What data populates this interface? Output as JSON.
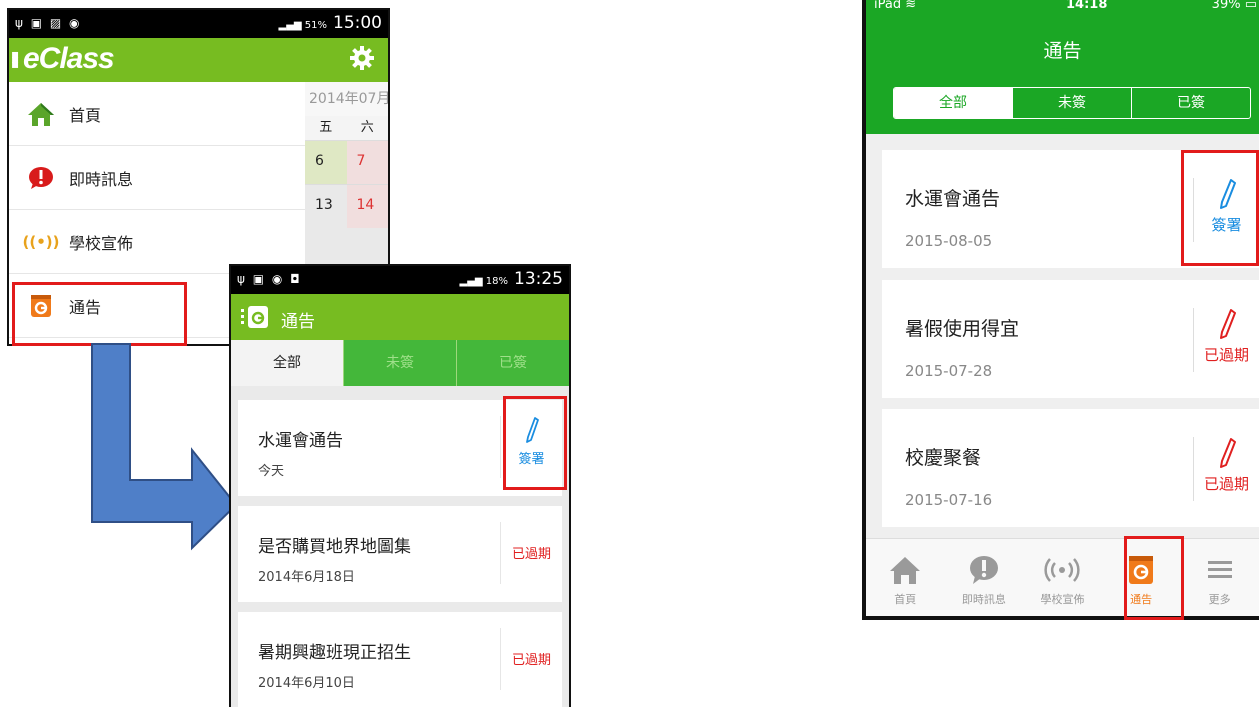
{
  "android_drawer": {
    "status": {
      "icons_left": "ψ 51",
      "battery": "51%",
      "time": "15:00"
    },
    "app_logo": "eClass",
    "calendar": {
      "month": "2014年07月",
      "weekdays": [
        "五",
        "六"
      ],
      "rows": [
        [
          "6",
          "7"
        ],
        [
          "13",
          "14"
        ]
      ]
    },
    "menu": [
      {
        "label": "首頁",
        "icon": "home-icon"
      },
      {
        "label": "即時訊息",
        "icon": "chat-alert-icon"
      },
      {
        "label": "學校宣佈",
        "icon": "broadcast-icon"
      },
      {
        "label": "通告",
        "icon": "notice-icon"
      }
    ]
  },
  "android_notices": {
    "status": {
      "battery": "18%",
      "time": "13:25"
    },
    "title": "通告",
    "tabs": [
      "全部",
      "未簽",
      "已簽"
    ],
    "notices": [
      {
        "title": "水運會通告",
        "date": "今天",
        "action": "簽署"
      },
      {
        "title": "是否購買地界地圖集",
        "date": "2014年6月18日",
        "action": "已過期"
      },
      {
        "title": "暑期興趣班現正招生",
        "date": "2014年6月10日",
        "action": "已過期"
      }
    ]
  },
  "ipad": {
    "status": {
      "carrier": "iPad",
      "time": "14:18",
      "battery": "39%"
    },
    "title": "通告",
    "tabs": [
      "全部",
      "未簽",
      "已簽"
    ],
    "notices": [
      {
        "title": "水運會通告",
        "date": "2015-08-05",
        "action": "簽署"
      },
      {
        "title": "暑假使用得宜",
        "date": "2015-07-28",
        "action": "已過期"
      },
      {
        "title": "校慶聚餐",
        "date": "2015-07-16",
        "action": "已過期"
      }
    ],
    "tabbar": [
      {
        "label": "首頁",
        "icon": "home-icon"
      },
      {
        "label": "即時訊息",
        "icon": "chat-alert-icon"
      },
      {
        "label": "學校宣佈",
        "icon": "broadcast-icon"
      },
      {
        "label": "通告",
        "icon": "notice-icon"
      },
      {
        "label": "更多",
        "icon": "menu-icon"
      }
    ]
  },
  "colors": {
    "android_green": "#77bc21",
    "ios_green": "#1ba725",
    "highlight_red": "#e21b1b",
    "arrow_blue": "#4f7fc8"
  }
}
